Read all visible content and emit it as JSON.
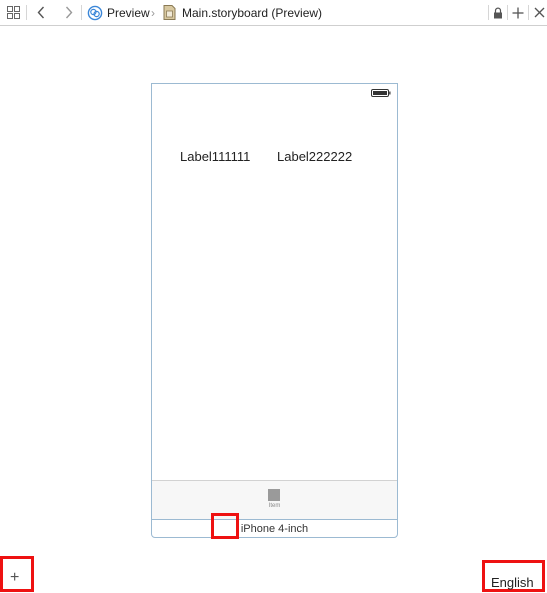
{
  "jumpbar": {
    "breadcrumb": {
      "mode_label": "Preview",
      "file_label": "Main.storyboard (Preview)"
    }
  },
  "preview": {
    "labels": [
      "Label111111",
      "Label222222"
    ],
    "tab_item_label": "Item",
    "device_label": "iPhone 4-inch"
  },
  "footer": {
    "add_glyph": "+",
    "language": "English"
  },
  "colors": {
    "device_border": "#9cbad2",
    "highlight": "#ee1111",
    "preview_icon": "#3a86d8"
  }
}
